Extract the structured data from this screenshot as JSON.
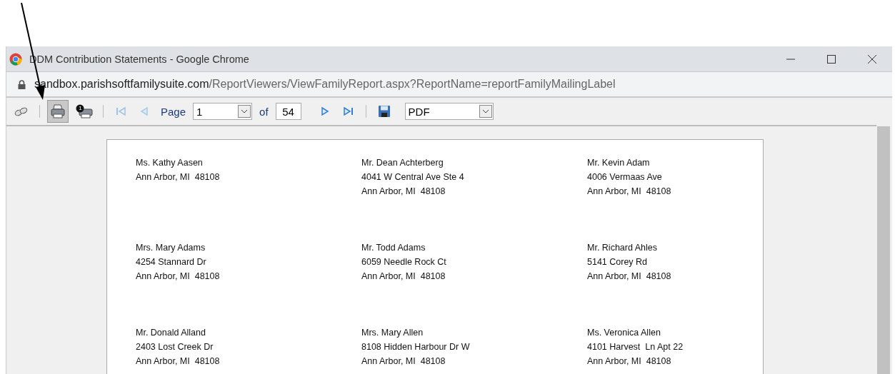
{
  "window": {
    "title": "DDM Contribution Statements - Google Chrome"
  },
  "address_bar": {
    "host": "sandbox.parishsoftfamilysuite.com",
    "path": "/ReportViewers/ViewFamilyReport.aspx?ReportName=reportFamilyMailingLabel"
  },
  "toolbar": {
    "buttons": [
      {
        "kind": "glasses",
        "selected": false
      },
      {
        "kind": "print",
        "selected": true
      },
      {
        "kind": "print-one",
        "selected": false,
        "badge": "1"
      }
    ],
    "page_label": "Page",
    "page": "1",
    "of_label": "of",
    "page_count": "54",
    "format": "PDF"
  },
  "labels": [
    {
      "lines": [
        "Ms. Kathy Aasen",
        "Ann Arbor, MI  48108"
      ]
    },
    {
      "lines": [
        "Mr. Dean Achterberg",
        "4041 W Central Ave Ste 4",
        "Ann Arbor, MI  48108"
      ]
    },
    {
      "lines": [
        "Mr. Kevin Adam",
        "4006 Vermaas Ave",
        "Ann Arbor, MI  48108"
      ]
    },
    {
      "lines": [
        "Mrs. Mary Adams",
        "4254 Stannard Dr",
        "Ann Arbor, MI  48108"
      ]
    },
    {
      "lines": [
        "Mr. Todd Adams",
        "6059 Needle Rock Ct",
        "Ann Arbor, MI  48108"
      ]
    },
    {
      "lines": [
        "Mr. Richard Ahles",
        "5141 Corey Rd",
        "Ann Arbor, MI  48108"
      ]
    },
    {
      "lines": [
        "Mr. Donald Alland",
        "2403 Lost Creek Dr",
        "Ann Arbor, MI  48108"
      ]
    },
    {
      "lines": [
        "Mrs. Mary Allen",
        "8108 Hidden Harbour Dr W",
        "Ann Arbor, MI  48108"
      ]
    },
    {
      "lines": [
        "Ms. Veronica Allen",
        "4101 Harvest  Ln Apt 22",
        "Ann Arbor, MI  48108"
      ]
    }
  ]
}
